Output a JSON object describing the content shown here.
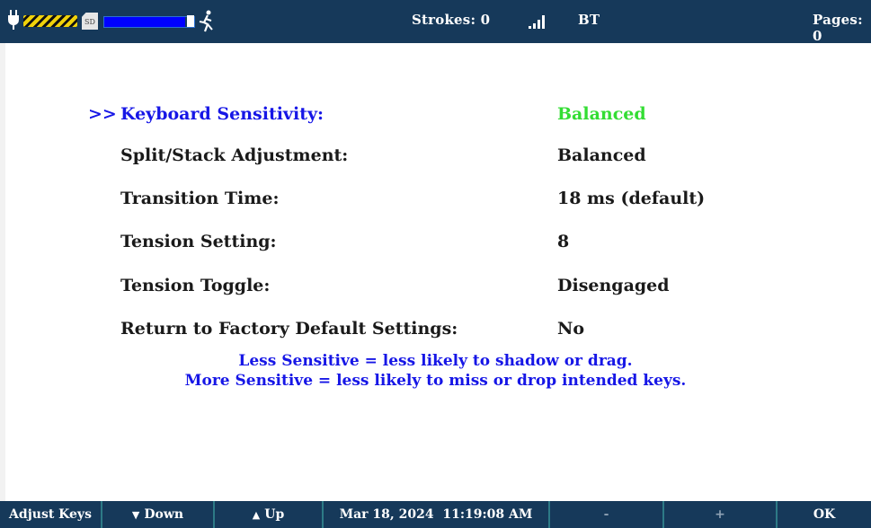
{
  "status_bar": {
    "strokes_label": "Strokes: 0",
    "signal_icon": "signal-bars-icon",
    "bt_label": "BT",
    "pages_label": "Pages: 0",
    "battery_level": 0.9
  },
  "settings": [
    {
      "label": "Keyboard Sensitivity:",
      "value": "Balanced",
      "selected": true
    },
    {
      "label": "Split/Stack Adjustment:",
      "value": "Balanced"
    },
    {
      "label": "Transition Time:",
      "value": "18 ms (default)"
    },
    {
      "label": "Tension Setting:",
      "value": "8"
    },
    {
      "label": "Tension Toggle:",
      "value": "Disengaged"
    },
    {
      "label": "Return to Factory Default Settings:",
      "value": "No"
    }
  ],
  "selection_marker": ">>",
  "hints": [
    "Less Sensitive = less likely to shadow or drag.",
    "More Sensitive = less likely to miss or drop intended keys."
  ],
  "bottom_bar": {
    "adjust_keys": "Adjust Keys",
    "down": "Down",
    "up": "Up",
    "datetime": "Mar 18, 2024  11:19:08 AM",
    "minus": "-",
    "plus": "+",
    "ok": "OK"
  },
  "colors": {
    "bar_bg": "#16395a",
    "selected_label": "#1616e6",
    "selected_value": "#33dd33"
  }
}
